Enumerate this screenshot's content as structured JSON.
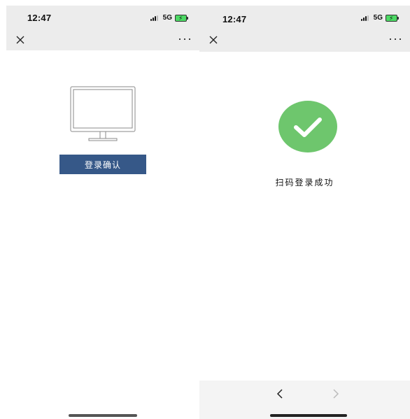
{
  "left_screen": {
    "status_bar": {
      "time": "12:47",
      "network": "5G"
    },
    "nav": {
      "close_icon": "close-icon",
      "more_label": "···"
    },
    "monitor_icon": "monitor-icon",
    "login_button_label": "登录确认"
  },
  "right_screen": {
    "status_bar": {
      "time": "12:47",
      "network": "5G"
    },
    "nav": {
      "close_icon": "close-icon",
      "more_label": "···"
    },
    "success_icon": "check-circle-icon",
    "success_text": "扫码登录成功",
    "bottom_nav": {
      "back_icon": "chevron-left-icon",
      "forward_icon": "chevron-right-icon"
    }
  },
  "colors": {
    "button_blue": "#365888",
    "success_green": "#6ec66d",
    "bar_gray": "#ececec"
  }
}
